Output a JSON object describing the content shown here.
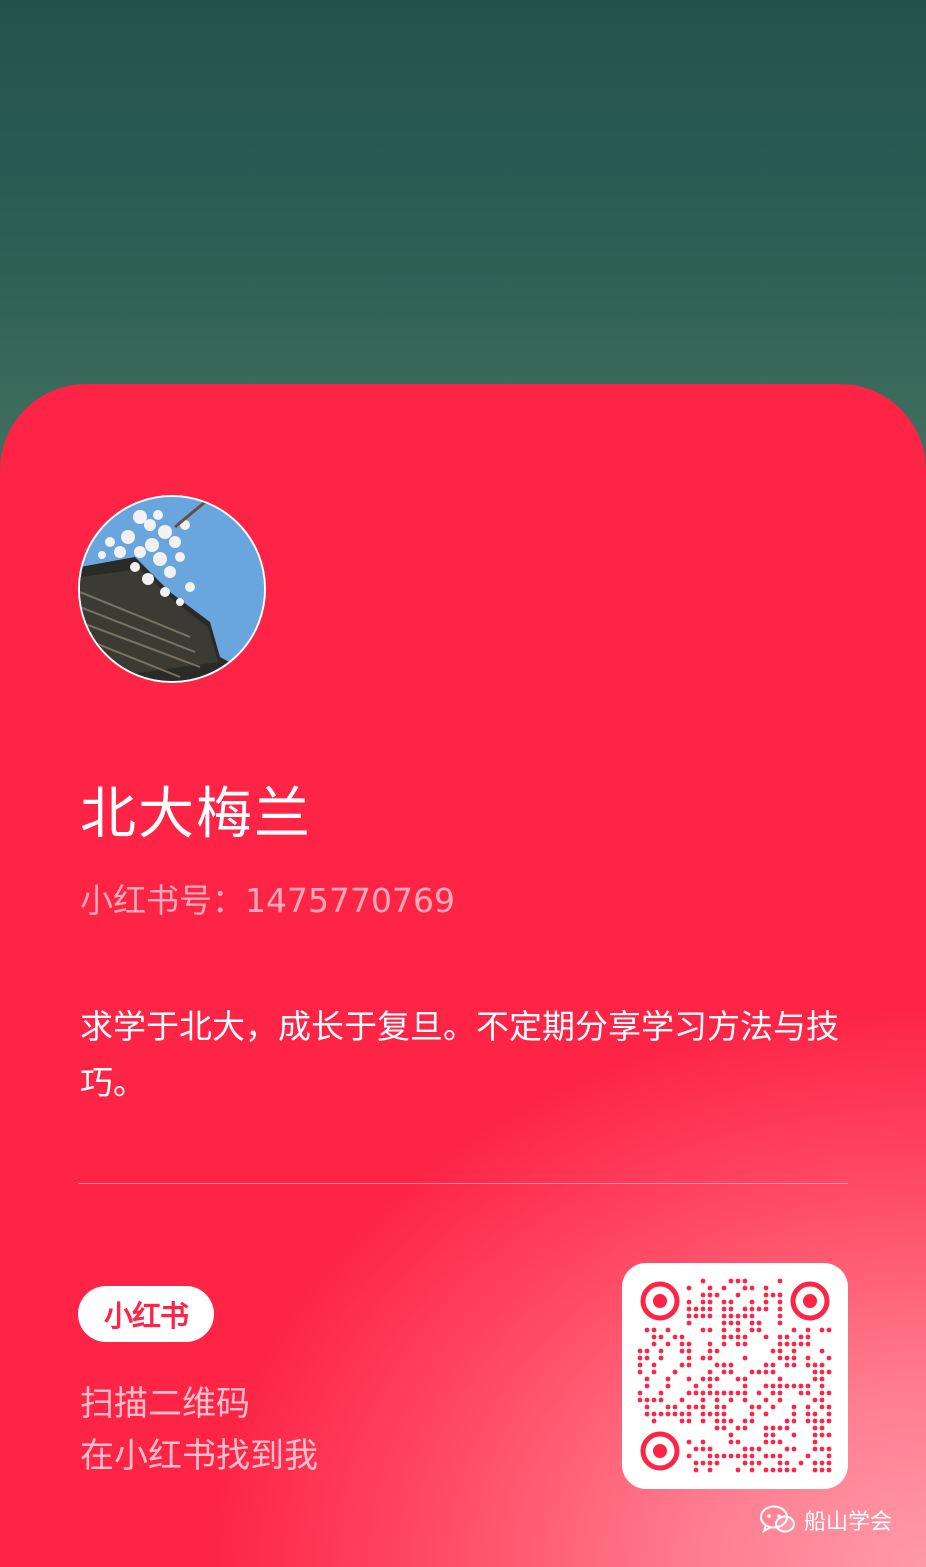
{
  "profile": {
    "name": "北大梅兰",
    "id_text": "小红书号：1475770769",
    "bio": "求学于北大，成长于复旦。不定期分享学习方法与技巧。"
  },
  "footer": {
    "brand_logo_text": "小红书",
    "scan_line1": "扫描二维码",
    "scan_line2": "在小红书找到我"
  },
  "watermark": {
    "icon": "wechat-icon",
    "text": "船山学会"
  },
  "colors": {
    "card_red": "#fd2446",
    "background_teal": "#2f6155",
    "qr_dot": "#fd2446"
  }
}
